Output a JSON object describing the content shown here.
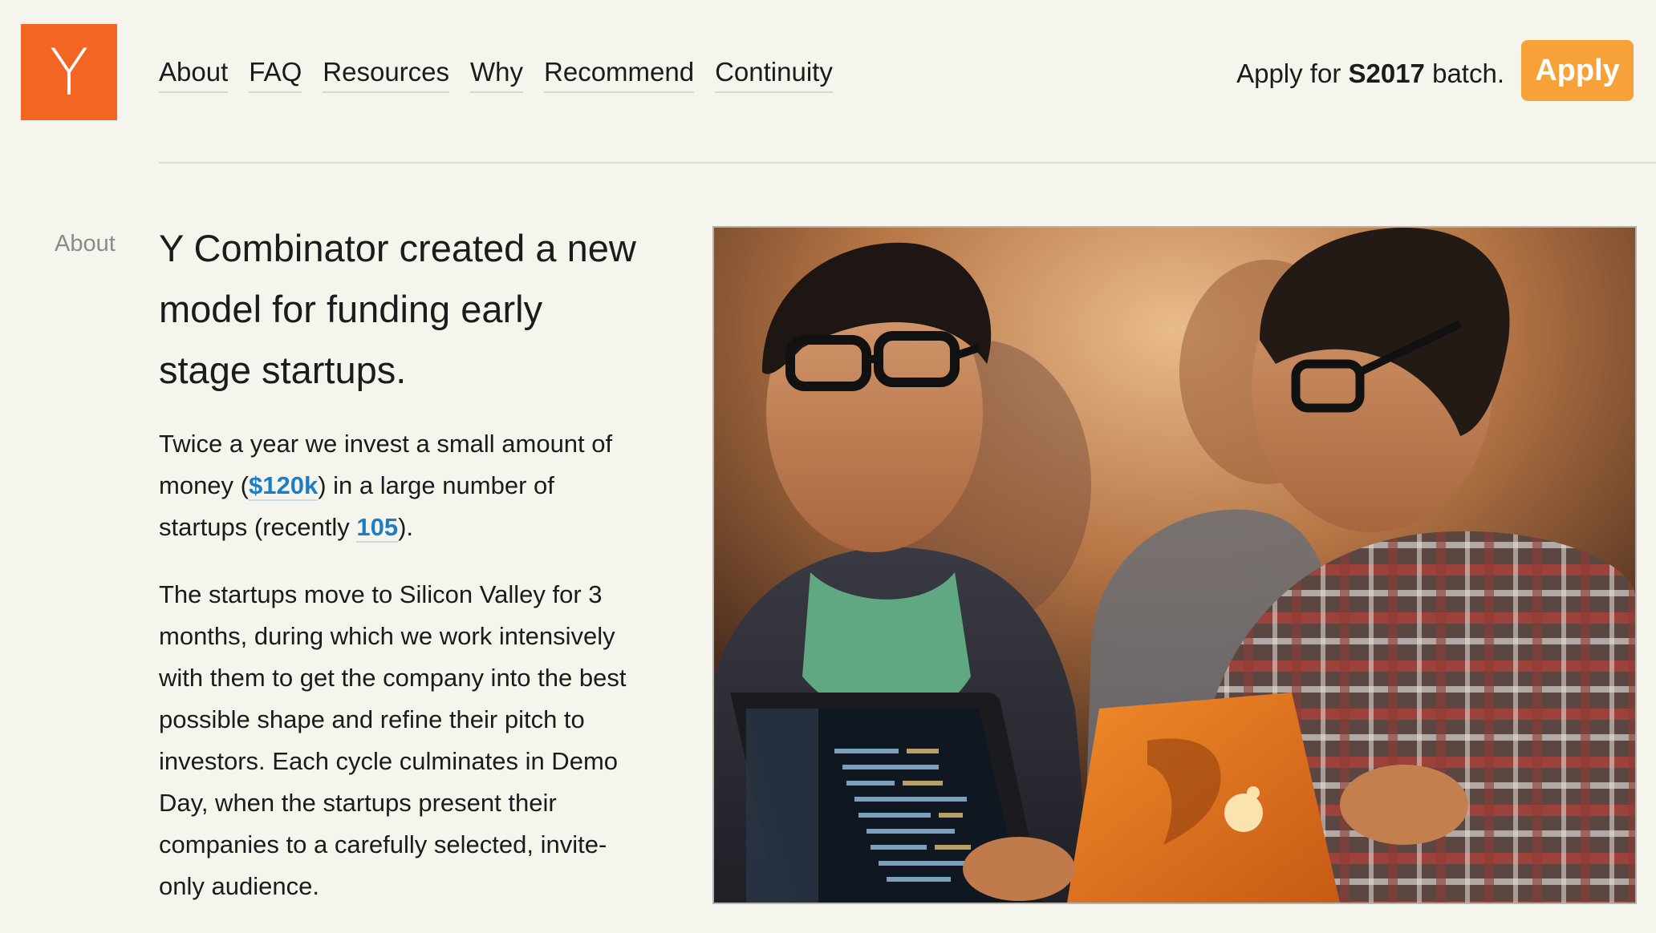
{
  "logo": {
    "letter": "Y"
  },
  "nav": {
    "items": [
      {
        "label": "About"
      },
      {
        "label": "FAQ"
      },
      {
        "label": "Resources"
      },
      {
        "label": "Why"
      },
      {
        "label": "Recommend"
      },
      {
        "label": "Continuity"
      }
    ]
  },
  "apply": {
    "prefix": "Apply for ",
    "batch": "S2017",
    "suffix": " batch.",
    "button_label": "Apply"
  },
  "section": {
    "label": "About"
  },
  "main": {
    "headline": "Y Combinator created a new model for funding early stage startups.",
    "para1_part1": "Twice a year we invest a small amount of money (",
    "para1_link1": "$120k",
    "para1_part2": ") in a large number of startups (recently ",
    "para1_link2": "105",
    "para1_part3": ").",
    "para2": "The startups move to Silicon Valley for 3 months, during which we work intensively with them to get the company into the best possible shape and refine their pitch to investors. Each cycle culminates in Demo Day, when the startups present their companies to a carefully selected, invite-only audience."
  },
  "colors": {
    "brand_orange": "#f26522",
    "apply_button": "#f6a239",
    "link_blue": "#1d7ec4",
    "background": "#f5f5ee"
  }
}
